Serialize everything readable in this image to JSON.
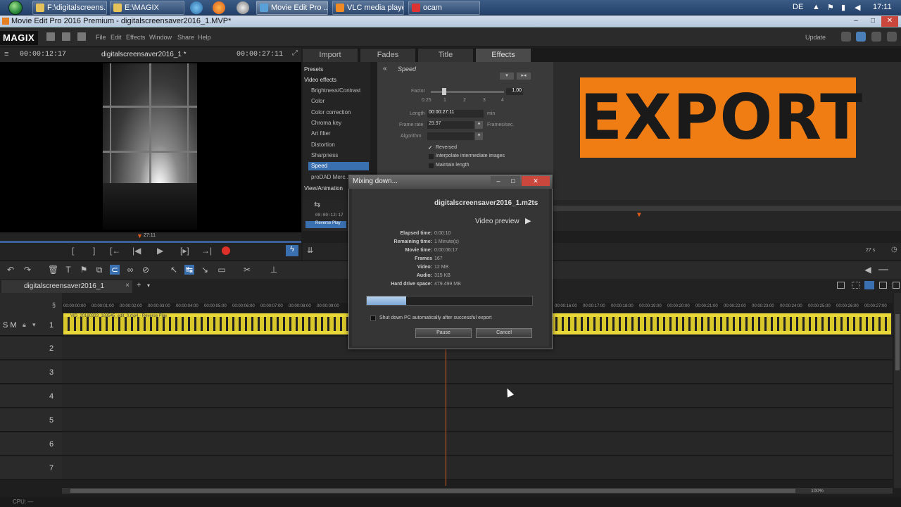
{
  "taskbar": {
    "items": [
      {
        "label": "F:\\digitalscreens..."
      },
      {
        "label": "E:\\MAGIX"
      },
      {
        "label": "Movie Edit Pro ..."
      },
      {
        "label": "VLC media player"
      },
      {
        "label": "ocam"
      }
    ],
    "lang": "DE",
    "clock": "17:11"
  },
  "window": {
    "title": "Movie Edit Pro 2016 Premium - digitalscreensaver2016_1.MVP*",
    "controls": {
      "min": "‒",
      "max": "□",
      "close": "✕"
    }
  },
  "menu": {
    "logo": "MAGIX",
    "items": [
      "File",
      "Edit",
      "Effects",
      "Window",
      "Share",
      "Help"
    ],
    "update": "Update"
  },
  "preview": {
    "timecode_left": "00:00:12:17",
    "project_name": "digitalscreensaver2016_1 *",
    "timecode_right": "00:00:27:11",
    "marker_time": "27:11",
    "controls": {
      "mark_in": "[",
      "mark_out": "]",
      "prev_marker": "[←",
      "prev": "|◀",
      "play": "▶",
      "next_marker": "[▸]",
      "next": "→|"
    }
  },
  "tabs": [
    "Import",
    "Fades",
    "Title",
    "Effects"
  ],
  "effects": {
    "presets": "Presets",
    "video_effects": "Video effects",
    "items": [
      "Brightness/Contrast",
      "Color",
      "Color correction",
      "Chroma key",
      "Art filter",
      "Distortion",
      "Sharpness",
      "Speed",
      "proDAD Merc..."
    ],
    "selected": "Speed",
    "view_animation": "View/Animation",
    "timecode": "00:00:12:17",
    "reverse_play": "Reverse Play"
  },
  "speed_panel": {
    "title": "Speed",
    "factor_label": "Factor",
    "factor_value": "1.00",
    "factor_ticks": [
      "0.25",
      "1",
      "2",
      "3",
      "4"
    ],
    "length_label": "Length",
    "length_value": "00:00:27:11",
    "length_unit": "min",
    "frame_rate_label": "Frame rate",
    "frame_rate_value": "29.97",
    "frame_rate_unit": "Frames/sec.",
    "algorithm_label": "Algorithm",
    "options": [
      {
        "label": "Reversed",
        "checked": true
      },
      {
        "label": "Interpolate intermediate images",
        "checked": false
      },
      {
        "label": "Maintain length",
        "checked": false
      }
    ]
  },
  "banner": {
    "text": "EXPORT",
    "color": "#f07d14"
  },
  "timeline": {
    "tab": "digitalscreensaver2016_1",
    "ruler_labels": [
      "00:00:00:00",
      "00:00:01:00",
      "00:00:02:00",
      "00:00:03:00",
      "00:00:04:00",
      "00:00:05:00",
      "00:00:06:00",
      "00:00:07:00",
      "00:00:08:00",
      "00:00:09:00",
      "00:00:10:00",
      "00:00:11:00",
      "00:00:12:00"
    ],
    "ruler_labels_right": [
      "00:00:16:00",
      "00:00:17:00",
      "00:00:18:00",
      "00:00:19:00",
      "00:00:20:00",
      "00:00:21:00",
      "00:00:22:00",
      "00:00:23:00",
      "00:00:24:00",
      "00:00:25:00",
      "00:00:26:00",
      "00:00:27:00"
    ],
    "tracks": [
      "1",
      "2",
      "3",
      "4",
      "5",
      "6",
      "7"
    ],
    "track1_buttons": "S M",
    "clip_label": "VID_20160333_183545_edit_0.mp4 - Reverse Play",
    "zoom": "100%",
    "page": "27 s"
  },
  "dialog": {
    "title": "Mixing down...",
    "filename": "digitalscreensaver2016_1.m2ts",
    "video_preview": "Video preview",
    "stats": [
      {
        "label": "Elapsed time:",
        "value": "0:00:10"
      },
      {
        "label": "Remaining time:",
        "value": "1 Minute(s)"
      },
      {
        "label": "Movie time:",
        "value": "0:00:06:17"
      },
      {
        "label": "Frames",
        "value": "167"
      },
      {
        "label": "Video:",
        "value": "12 MB"
      },
      {
        "label": "Audio:",
        "value": "315 KB"
      },
      {
        "label": "Hard drive space:",
        "value": "479.499 MB"
      }
    ],
    "progress": 0.24,
    "shutdown_label": "Shut down PC automatically after successful export",
    "pause": "Pause",
    "cancel": "Cancel"
  },
  "status": {
    "cpu": "CPU: —"
  }
}
